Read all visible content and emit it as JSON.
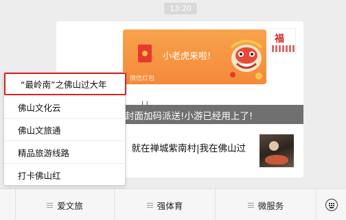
{
  "timestamp": "13:20",
  "message": {
    "red_packet": {
      "title": "小老虎来啦!",
      "footer": "微信红包"
    },
    "banner_text": "封面加码派送!小游已经用上了!",
    "article_title": "，就在禅城紫南村|我在佛山过",
    "small_marks": "| |"
  },
  "popup_menu": {
    "items": [
      {
        "label": "“最岭南”之佛山过大年"
      },
      {
        "label": "佛山文化云"
      },
      {
        "label": "佛山文旅通"
      },
      {
        "label": "精品旅游线路"
      },
      {
        "label": "打卡佛山红"
      }
    ]
  },
  "menubar": {
    "items": [
      {
        "label": "爱文旅"
      },
      {
        "label": "强体育"
      },
      {
        "label": "微服务"
      }
    ]
  },
  "colors": {
    "highlight_border": "#e02020",
    "red_packet_bg": "#f48a3a",
    "banner_bg": "#707070"
  },
  "icons": {
    "menu_item": "hamburger-icon",
    "keyboard": "keyboard-icon"
  }
}
